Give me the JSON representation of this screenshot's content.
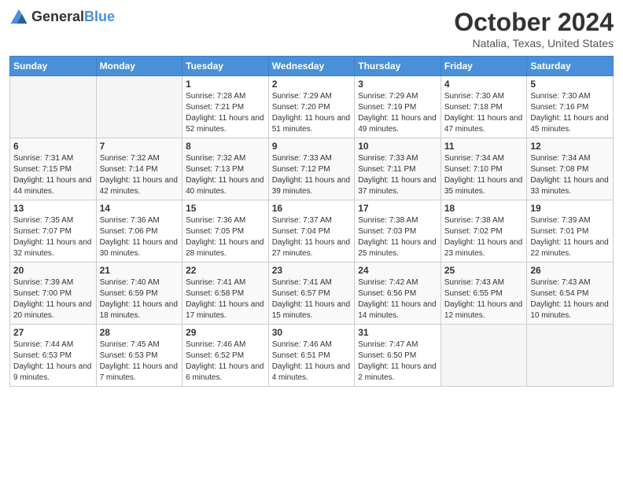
{
  "header": {
    "logo_general": "General",
    "logo_blue": "Blue",
    "title": "October 2024",
    "location": "Natalia, Texas, United States"
  },
  "days_of_week": [
    "Sunday",
    "Monday",
    "Tuesday",
    "Wednesday",
    "Thursday",
    "Friday",
    "Saturday"
  ],
  "weeks": [
    [
      {
        "day": "",
        "empty": true
      },
      {
        "day": "",
        "empty": true
      },
      {
        "day": "1",
        "sunrise": "Sunrise: 7:28 AM",
        "sunset": "Sunset: 7:21 PM",
        "daylight": "Daylight: 11 hours and 52 minutes."
      },
      {
        "day": "2",
        "sunrise": "Sunrise: 7:29 AM",
        "sunset": "Sunset: 7:20 PM",
        "daylight": "Daylight: 11 hours and 51 minutes."
      },
      {
        "day": "3",
        "sunrise": "Sunrise: 7:29 AM",
        "sunset": "Sunset: 7:19 PM",
        "daylight": "Daylight: 11 hours and 49 minutes."
      },
      {
        "day": "4",
        "sunrise": "Sunrise: 7:30 AM",
        "sunset": "Sunset: 7:18 PM",
        "daylight": "Daylight: 11 hours and 47 minutes."
      },
      {
        "day": "5",
        "sunrise": "Sunrise: 7:30 AM",
        "sunset": "Sunset: 7:16 PM",
        "daylight": "Daylight: 11 hours and 45 minutes."
      }
    ],
    [
      {
        "day": "6",
        "sunrise": "Sunrise: 7:31 AM",
        "sunset": "Sunset: 7:15 PM",
        "daylight": "Daylight: 11 hours and 44 minutes."
      },
      {
        "day": "7",
        "sunrise": "Sunrise: 7:32 AM",
        "sunset": "Sunset: 7:14 PM",
        "daylight": "Daylight: 11 hours and 42 minutes."
      },
      {
        "day": "8",
        "sunrise": "Sunrise: 7:32 AM",
        "sunset": "Sunset: 7:13 PM",
        "daylight": "Daylight: 11 hours and 40 minutes."
      },
      {
        "day": "9",
        "sunrise": "Sunrise: 7:33 AM",
        "sunset": "Sunset: 7:12 PM",
        "daylight": "Daylight: 11 hours and 39 minutes."
      },
      {
        "day": "10",
        "sunrise": "Sunrise: 7:33 AM",
        "sunset": "Sunset: 7:11 PM",
        "daylight": "Daylight: 11 hours and 37 minutes."
      },
      {
        "day": "11",
        "sunrise": "Sunrise: 7:34 AM",
        "sunset": "Sunset: 7:10 PM",
        "daylight": "Daylight: 11 hours and 35 minutes."
      },
      {
        "day": "12",
        "sunrise": "Sunrise: 7:34 AM",
        "sunset": "Sunset: 7:08 PM",
        "daylight": "Daylight: 11 hours and 33 minutes."
      }
    ],
    [
      {
        "day": "13",
        "sunrise": "Sunrise: 7:35 AM",
        "sunset": "Sunset: 7:07 PM",
        "daylight": "Daylight: 11 hours and 32 minutes."
      },
      {
        "day": "14",
        "sunrise": "Sunrise: 7:36 AM",
        "sunset": "Sunset: 7:06 PM",
        "daylight": "Daylight: 11 hours and 30 minutes."
      },
      {
        "day": "15",
        "sunrise": "Sunrise: 7:36 AM",
        "sunset": "Sunset: 7:05 PM",
        "daylight": "Daylight: 11 hours and 28 minutes."
      },
      {
        "day": "16",
        "sunrise": "Sunrise: 7:37 AM",
        "sunset": "Sunset: 7:04 PM",
        "daylight": "Daylight: 11 hours and 27 minutes."
      },
      {
        "day": "17",
        "sunrise": "Sunrise: 7:38 AM",
        "sunset": "Sunset: 7:03 PM",
        "daylight": "Daylight: 11 hours and 25 minutes."
      },
      {
        "day": "18",
        "sunrise": "Sunrise: 7:38 AM",
        "sunset": "Sunset: 7:02 PM",
        "daylight": "Daylight: 11 hours and 23 minutes."
      },
      {
        "day": "19",
        "sunrise": "Sunrise: 7:39 AM",
        "sunset": "Sunset: 7:01 PM",
        "daylight": "Daylight: 11 hours and 22 minutes."
      }
    ],
    [
      {
        "day": "20",
        "sunrise": "Sunrise: 7:39 AM",
        "sunset": "Sunset: 7:00 PM",
        "daylight": "Daylight: 11 hours and 20 minutes."
      },
      {
        "day": "21",
        "sunrise": "Sunrise: 7:40 AM",
        "sunset": "Sunset: 6:59 PM",
        "daylight": "Daylight: 11 hours and 18 minutes."
      },
      {
        "day": "22",
        "sunrise": "Sunrise: 7:41 AM",
        "sunset": "Sunset: 6:58 PM",
        "daylight": "Daylight: 11 hours and 17 minutes."
      },
      {
        "day": "23",
        "sunrise": "Sunrise: 7:41 AM",
        "sunset": "Sunset: 6:57 PM",
        "daylight": "Daylight: 11 hours and 15 minutes."
      },
      {
        "day": "24",
        "sunrise": "Sunrise: 7:42 AM",
        "sunset": "Sunset: 6:56 PM",
        "daylight": "Daylight: 11 hours and 14 minutes."
      },
      {
        "day": "25",
        "sunrise": "Sunrise: 7:43 AM",
        "sunset": "Sunset: 6:55 PM",
        "daylight": "Daylight: 11 hours and 12 minutes."
      },
      {
        "day": "26",
        "sunrise": "Sunrise: 7:43 AM",
        "sunset": "Sunset: 6:54 PM",
        "daylight": "Daylight: 11 hours and 10 minutes."
      }
    ],
    [
      {
        "day": "27",
        "sunrise": "Sunrise: 7:44 AM",
        "sunset": "Sunset: 6:53 PM",
        "daylight": "Daylight: 11 hours and 9 minutes."
      },
      {
        "day": "28",
        "sunrise": "Sunrise: 7:45 AM",
        "sunset": "Sunset: 6:53 PM",
        "daylight": "Daylight: 11 hours and 7 minutes."
      },
      {
        "day": "29",
        "sunrise": "Sunrise: 7:46 AM",
        "sunset": "Sunset: 6:52 PM",
        "daylight": "Daylight: 11 hours and 6 minutes."
      },
      {
        "day": "30",
        "sunrise": "Sunrise: 7:46 AM",
        "sunset": "Sunset: 6:51 PM",
        "daylight": "Daylight: 11 hours and 4 minutes."
      },
      {
        "day": "31",
        "sunrise": "Sunrise: 7:47 AM",
        "sunset": "Sunset: 6:50 PM",
        "daylight": "Daylight: 11 hours and 2 minutes."
      },
      {
        "day": "",
        "empty": true
      },
      {
        "day": "",
        "empty": true
      }
    ]
  ]
}
